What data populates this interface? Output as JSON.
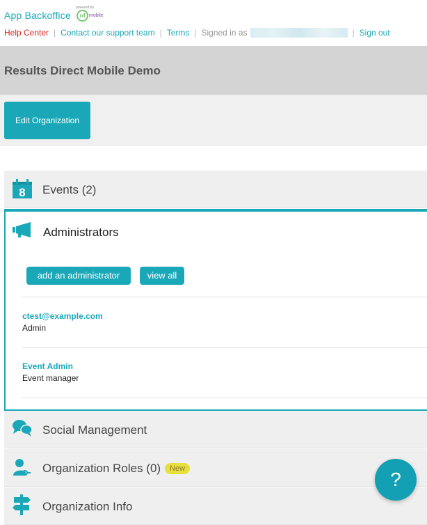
{
  "header": {
    "brand": "App Backoffice",
    "partner_powered": "powered by",
    "partner_rd": "rd",
    "partner_mobile": "mobile",
    "links": {
      "help": "Help Center",
      "contact": "Contact our support team",
      "terms": "Terms",
      "signed_in": "Signed in as",
      "signout": "Sign out"
    }
  },
  "organization": {
    "title": "Results Direct Mobile Demo",
    "edit_label": "Edit Organization"
  },
  "sections": {
    "events": {
      "label": "Events (2)",
      "calendar_day": "8"
    },
    "administrators": {
      "label": "Administrators",
      "add_label": "add an administrator",
      "view_all_label": "view all",
      "entries": [
        {
          "name": "ctest@example.com",
          "role": "Admin"
        },
        {
          "name": "Event Admin",
          "role": "Event manager"
        }
      ]
    },
    "social": {
      "label": "Social Management"
    },
    "roles": {
      "label": "Organization Roles (0)",
      "badge": "New"
    },
    "info": {
      "label": "Organization Info"
    }
  },
  "help_fab": {
    "label": "?"
  },
  "colors": {
    "accent": "#1aa8b8",
    "help_link": "#d9261c",
    "badge": "#e6e03d"
  }
}
